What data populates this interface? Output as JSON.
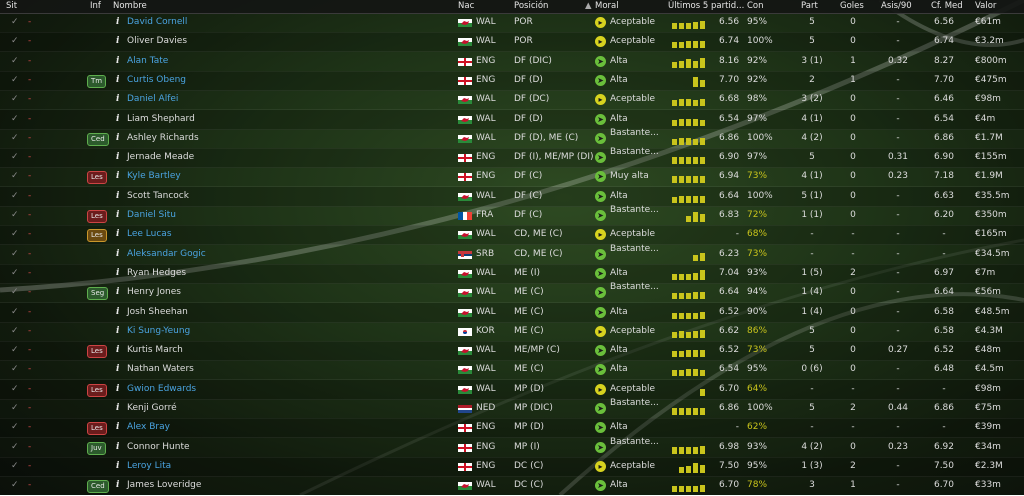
{
  "header": {
    "sit": "Sit",
    "inf": "Inf",
    "nombre": "Nombre",
    "nac": "Nac",
    "posicion": "Posición",
    "moral": "Moral",
    "ultimos": "Últimos 5 partid...",
    "con": "Con",
    "part": "Part",
    "goles": "Goles",
    "asis": "Asis/90",
    "cfmed": "Cf. Med",
    "valor": "Valor"
  },
  "rows": [
    {
      "dash": "-",
      "badge": "",
      "info": "i",
      "name": "David Cornell",
      "nac": "WAL",
      "pos": "POR",
      "moral": "Aceptable",
      "avg": "6.56",
      "con": "95%",
      "part": "5",
      "goles": "0",
      "asis": "-",
      "cf": "6.56",
      "valor": "€61m"
    },
    {
      "dash": "-",
      "badge": "",
      "info": "i",
      "name": "Oliver Davies",
      "nac": "WAL",
      "pos": "POR",
      "moral": "Aceptable",
      "avg": "6.74",
      "con": "100%",
      "part": "5",
      "goles": "0",
      "asis": "-",
      "cf": "6.74",
      "valor": "€3.2m"
    },
    {
      "dash": "-",
      "badge": "",
      "info": "i",
      "name": "Alan Tate",
      "nac": "ENG",
      "pos": "DF (DIC)",
      "moral": "Alta",
      "avg": "8.16",
      "con": "92%",
      "part": "3 (1)",
      "goles": "1",
      "asis": "0.32",
      "cf": "8.27",
      "valor": "€800m"
    },
    {
      "dash": "-",
      "badge": "Tm",
      "info": "i",
      "name": "Curtis Obeng",
      "nac": "ENG",
      "pos": "DF (D)",
      "moral": "Alta",
      "avg": "7.70",
      "con": "92%",
      "part": "2",
      "goles": "1",
      "asis": "-",
      "cf": "7.70",
      "valor": "€475m"
    },
    {
      "dash": "-",
      "badge": "",
      "info": "i",
      "name": "Daniel Alfei",
      "nac": "WAL",
      "pos": "DF (DC)",
      "moral": "Aceptable",
      "avg": "6.68",
      "con": "98%",
      "part": "3 (2)",
      "goles": "0",
      "asis": "-",
      "cf": "6.46",
      "valor": "€98m"
    },
    {
      "dash": "-",
      "badge": "",
      "info": "i",
      "name": "Liam Shephard",
      "nac": "WAL",
      "pos": "DF (D)",
      "moral": "Alta",
      "avg": "6.54",
      "con": "97%",
      "part": "4 (1)",
      "goles": "0",
      "asis": "-",
      "cf": "6.54",
      "valor": "€4m"
    },
    {
      "dash": "-",
      "badge": "Ced",
      "info": "i",
      "name": "Ashley Richards",
      "nac": "WAL",
      "pos": "DF (D), ME (C)",
      "moral": "Bastante...",
      "avg": "6.86",
      "con": "100%",
      "part": "4 (2)",
      "goles": "0",
      "asis": "-",
      "cf": "6.86",
      "valor": "€1.7M"
    },
    {
      "dash": "-",
      "badge": "",
      "info": "i",
      "name": "Jernade Meade",
      "nac": "ENG",
      "pos": "DF (I), ME/MP (DI)",
      "moral": "Bastante...",
      "avg": "6.90",
      "con": "97%",
      "part": "5",
      "goles": "0",
      "asis": "0.31",
      "cf": "6.90",
      "valor": "€155m"
    },
    {
      "dash": "-",
      "badge": "Les",
      "info": "i",
      "name": "Kyle Bartley",
      "nac": "ENG",
      "pos": "DF (C)",
      "moral": "Muy alta",
      "avg": "6.94",
      "con": "73%",
      "part": "4 (1)",
      "goles": "0",
      "asis": "0.23",
      "cf": "7.18",
      "valor": "€1.9M"
    },
    {
      "dash": "-",
      "badge": "",
      "info": "i",
      "name": "Scott Tancock",
      "nac": "WAL",
      "pos": "DF (C)",
      "moral": "Alta",
      "avg": "6.64",
      "con": "100%",
      "part": "5 (1)",
      "goles": "0",
      "asis": "-",
      "cf": "6.63",
      "valor": "€35.5m"
    },
    {
      "dash": "-",
      "badge": "Les",
      "info": "i",
      "name": "Daniel Situ",
      "nac": "FRA",
      "pos": "DF (C)",
      "moral": "Bastante...",
      "avg": "6.83",
      "con": "72%",
      "part": "1 (1)",
      "goles": "0",
      "asis": "-",
      "cf": "6.20",
      "valor": "€350m"
    },
    {
      "dash": "-",
      "badge": "Les",
      "info": "i",
      "name": "Lee Lucas",
      "nac": "WAL",
      "pos": "CD, ME (C)",
      "moral": "Aceptable",
      "avg": "-",
      "con": "68%",
      "part": "-",
      "goles": "-",
      "asis": "-",
      "cf": "-",
      "valor": "€165m"
    },
    {
      "dash": "-",
      "badge": "",
      "info": "i",
      "name": "Aleksandar Gogic",
      "nac": "SRB",
      "pos": "CD, ME (C)",
      "moral": "Bastante...",
      "avg": "6.23",
      "con": "73%",
      "part": "-",
      "goles": "-",
      "asis": "-",
      "cf": "-",
      "valor": "€34.5m"
    },
    {
      "dash": "-",
      "badge": "",
      "info": "i",
      "name": "Ryan Hedges",
      "nac": "WAL",
      "pos": "ME (I)",
      "moral": "Alta",
      "avg": "7.04",
      "con": "93%",
      "part": "1 (5)",
      "goles": "2",
      "asis": "-",
      "cf": "6.97",
      "valor": "€7m"
    },
    {
      "dash": "-",
      "badge": "Seg",
      "info": "i",
      "name": "Henry Jones",
      "nac": "WAL",
      "pos": "ME (C)",
      "moral": "Bastante...",
      "avg": "6.64",
      "con": "94%",
      "part": "1 (4)",
      "goles": "0",
      "asis": "-",
      "cf": "6.64",
      "valor": "€56m"
    },
    {
      "dash": "-",
      "badge": "",
      "info": "i",
      "name": "Josh Sheehan",
      "nac": "WAL",
      "pos": "ME (C)",
      "moral": "Alta",
      "avg": "6.52",
      "con": "90%",
      "part": "1 (4)",
      "goles": "0",
      "asis": "-",
      "cf": "6.58",
      "valor": "€48.5m"
    },
    {
      "dash": "-",
      "badge": "",
      "info": "i",
      "name": "Ki Sung-Yeung",
      "nac": "KOR",
      "pos": "ME (C)",
      "moral": "Aceptable",
      "avg": "6.62",
      "con": "86%",
      "part": "5",
      "goles": "0",
      "asis": "-",
      "cf": "6.58",
      "valor": "€4.3M"
    },
    {
      "dash": "-",
      "badge": "Les",
      "info": "i",
      "name": "Kurtis March",
      "nac": "WAL",
      "pos": "ME/MP (C)",
      "moral": "Alta",
      "avg": "6.52",
      "con": "73%",
      "part": "5",
      "goles": "0",
      "asis": "0.27",
      "cf": "6.52",
      "valor": "€48m"
    },
    {
      "dash": "-",
      "badge": "",
      "info": "i",
      "name": "Nathan Waters",
      "nac": "WAL",
      "pos": "ME (C)",
      "moral": "Alta",
      "avg": "6.54",
      "con": "95%",
      "part": "0 (6)",
      "goles": "0",
      "asis": "-",
      "cf": "6.48",
      "valor": "€4.5m"
    },
    {
      "dash": "-",
      "badge": "Les",
      "info": "i",
      "name": "Gwion Edwards",
      "nac": "WAL",
      "pos": "MP (D)",
      "moral": "Aceptable",
      "avg": "6.70",
      "con": "64%",
      "part": "-",
      "goles": "-",
      "asis": "-",
      "cf": "-",
      "valor": "€98m"
    },
    {
      "dash": "-",
      "badge": "",
      "info": "i",
      "name": "Kenji Gorré",
      "nac": "NED",
      "pos": "MP (DIC)",
      "moral": "Bastante...",
      "avg": "6.86",
      "con": "100%",
      "part": "5",
      "goles": "2",
      "asis": "0.44",
      "cf": "6.86",
      "valor": "€75m"
    },
    {
      "dash": "-",
      "badge": "Les",
      "info": "i",
      "name": "Alex Bray",
      "nac": "ENG",
      "pos": "MP (D)",
      "moral": "Alta",
      "avg": "-",
      "con": "62%",
      "part": "-",
      "goles": "-",
      "asis": "-",
      "cf": "-",
      "valor": "€39m"
    },
    {
      "dash": "-",
      "badge": "Juv",
      "info": "i",
      "name": "Connor Hunte",
      "nac": "ENG",
      "pos": "MP (I)",
      "moral": "Bastante...",
      "avg": "6.98",
      "con": "93%",
      "part": "4 (2)",
      "goles": "0",
      "asis": "0.23",
      "cf": "6.92",
      "valor": "€34m"
    },
    {
      "dash": "-",
      "badge": "",
      "info": "i",
      "name": "Leroy Lita",
      "nac": "ENG",
      "pos": "DC (C)",
      "moral": "Aceptable",
      "avg": "7.50",
      "con": "95%",
      "part": "1 (3)",
      "goles": "2",
      "asis": "-",
      "cf": "7.50",
      "valor": "€2.3M"
    },
    {
      "dash": "-",
      "badge": "Ced",
      "info": "i",
      "name": "James Loveridge",
      "nac": "WAL",
      "pos": "DC (C)",
      "moral": "Alta",
      "avg": "6.70",
      "con": "78%",
      "part": "3",
      "goles": "1",
      "asis": "-",
      "cf": "6.70",
      "valor": "€33m"
    }
  ]
}
